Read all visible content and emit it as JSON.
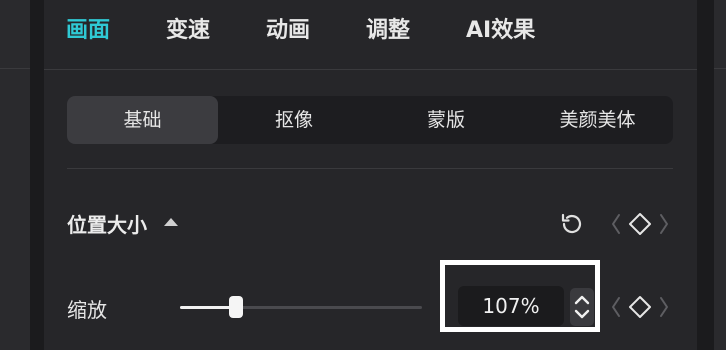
{
  "tabs": [
    {
      "label": "画面",
      "active": true
    },
    {
      "label": "变速",
      "active": false
    },
    {
      "label": "动画",
      "active": false
    },
    {
      "label": "调整",
      "active": false
    },
    {
      "label": "AI效果",
      "active": false
    }
  ],
  "subtabs": [
    {
      "label": "基础",
      "active": true
    },
    {
      "label": "抠像",
      "active": false
    },
    {
      "label": "蒙版",
      "active": false
    },
    {
      "label": "美颜美体",
      "active": false
    }
  ],
  "section": {
    "title": "位置大小",
    "icons": [
      "reset-icon",
      "prev-keyframe-icon",
      "keyframe-diamond-icon",
      "next-keyframe-icon",
      "caret-up-icon"
    ]
  },
  "scale": {
    "label": "缩放",
    "value_text": "107%",
    "slider_fraction": 0.23,
    "icons": [
      "stepper-icon",
      "prev-keyframe-icon",
      "keyframe-diamond-icon",
      "next-keyframe-icon"
    ]
  },
  "colors": {
    "accent": "#2fc9d4",
    "panel": "#262629",
    "background": "#1b1b1d"
  }
}
